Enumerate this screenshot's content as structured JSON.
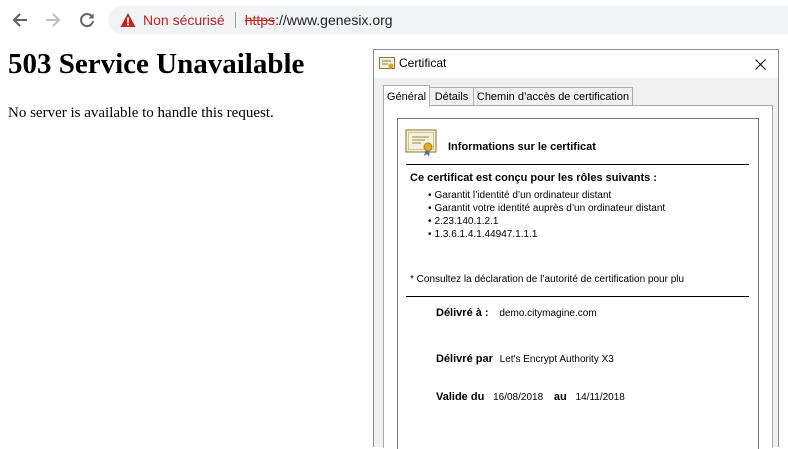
{
  "browser": {
    "security_label": "Non sécurisé",
    "url_scheme": "https",
    "url_rest": "://www.genesix.org"
  },
  "page": {
    "heading": "503 Service Unavailable",
    "message": "No server is available to handle this request."
  },
  "certificate_dialog": {
    "title": "Certificat",
    "tabs": [
      {
        "label": "Général",
        "active": true
      },
      {
        "label": "Détails",
        "active": false
      },
      {
        "label": "Chemin d’accès de certification",
        "active": false
      }
    ],
    "info_title": "Informations sur le certificat",
    "roles_title": "Ce certificat est conçu pour les rôles suivants :",
    "roles": [
      "Garantit l’identité d’un ordinateur distant",
      "Garantit votre identité auprès d’un ordinateur distant",
      "2.23.140.1.2.1",
      "1.3.6.1.4.1.44947.1.1.1"
    ],
    "note": "* Consultez la déclaration de l’autorité de certification pour plu",
    "issued_to_label": "Délivré à :",
    "issued_to_value": "demo.citymagine.com",
    "issued_by_label": "Délivré par",
    "issued_by_value": "Let's Encrypt Authority X3",
    "valid_from_label": "Valide du",
    "valid_from_value": "16/08/2018",
    "valid_to_label": "au",
    "valid_to_value": "14/11/2018"
  },
  "colors": {
    "warning_red": "#c5221f",
    "omnibox_bg": "#f1f3f4",
    "dialog_bg": "#f0f0f0"
  }
}
